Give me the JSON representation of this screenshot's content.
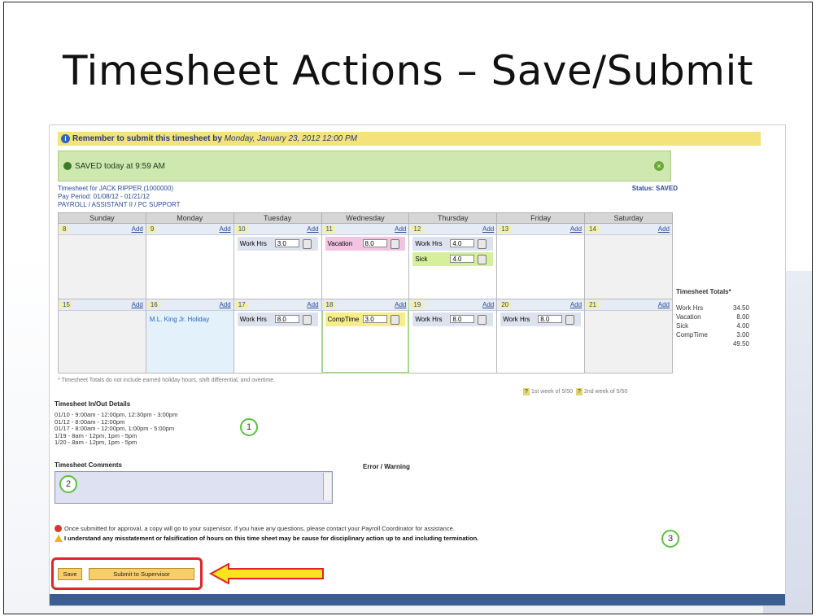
{
  "slide": {
    "title": "Timesheet Actions – Save/Submit"
  },
  "reminder": {
    "text": "Remember to submit this timesheet by",
    "deadline": "Monday, January 23, 2012 12:00 PM"
  },
  "saved": {
    "text": "SAVED today at 9:59 AM"
  },
  "timesheet_info": {
    "line1": "Timesheet for JACK RIPPER (1000000)",
    "line2": "Pay Period: 01/08/12 - 01/21/12",
    "line3": "PAYROLL / ASSISTANT II / PC SUPPORT",
    "status": "Status: SAVED"
  },
  "grid": {
    "headers": [
      "Sunday",
      "Monday",
      "Tuesday",
      "Wednesday",
      "Thursday",
      "Friday",
      "Saturday"
    ],
    "add_label": "Add",
    "week1_days": [
      "8",
      "9",
      "10",
      "11",
      "12",
      "13",
      "14"
    ],
    "week2_days": [
      "15",
      "16",
      "17",
      "18",
      "19",
      "20",
      "21"
    ],
    "entries": {
      "w1_tue": {
        "label": "Work Hrs",
        "value": "3.0"
      },
      "w1_wed": {
        "label": "Vacation",
        "value": "8.0"
      },
      "w1_thu": {
        "label": "Work Hrs",
        "value": "4.0"
      },
      "w1_thu_sick": {
        "label": "Sick",
        "value": "4.0"
      },
      "w2_tue": {
        "label": "Work Hrs",
        "value": "8.0"
      },
      "w2_wed": {
        "label": "CompTime",
        "value": "3.0"
      },
      "w2_thu": {
        "label": "Work Hrs",
        "value": "8.0"
      },
      "w2_fri": {
        "label": "Work Hrs",
        "value": "8.0"
      }
    },
    "holiday": "M.L. King Jr. Holiday"
  },
  "totals": {
    "title": "Timesheet Totals*",
    "rows": [
      {
        "label": "Work Hrs",
        "value": "34.50"
      },
      {
        "label": "Vacation",
        "value": "8.00"
      },
      {
        "label": "Sick",
        "value": "4.00"
      },
      {
        "label": "CompTime",
        "value": "3.00"
      }
    ],
    "grand_total": "49.50"
  },
  "footnote": "* Timesheet Totals do not include earned holiday hours, shift differential, and overtime.",
  "week_keys": {
    "first": "1st week of 5/50",
    "second": "2nd week of 5/50"
  },
  "inout": {
    "heading": "Timesheet In/Out Details",
    "lines": [
      "01/10 - 9:00am - 12:00pm, 12:30pm - 3:00pm",
      "01/12 - 8:00am - 12:00pm",
      "01/17 - 8:00am - 12:00pm, 1:00pm - 5:00pm",
      "1/19 - 8am - 12pm, 1pm - 5pm",
      "1/20 - 8am - 12pm, 1pm - 5pm"
    ]
  },
  "comments": {
    "heading": "Timesheet Comments",
    "value": ""
  },
  "error_warning": "Error / Warning",
  "notices": {
    "info": "Once submitted for approval, a copy will go to your supervisor. If you have any questions, please contact your Payroll Coordinator for assistance.",
    "warning": "I understand any misstatement or falsification of hours on this time sheet may be cause for disciplinary action up to and including termination."
  },
  "buttons": {
    "save": "Save",
    "submit": "Submit to Supervisor"
  },
  "callouts": [
    "1",
    "2",
    "3"
  ],
  "colors": {
    "highlight_box": "#e0242a",
    "arrow_fill": "#f8e51c",
    "callout_ring": "#58c43a",
    "reminder_bg": "#f4e27a",
    "saved_bg": "#cfe8b0"
  }
}
